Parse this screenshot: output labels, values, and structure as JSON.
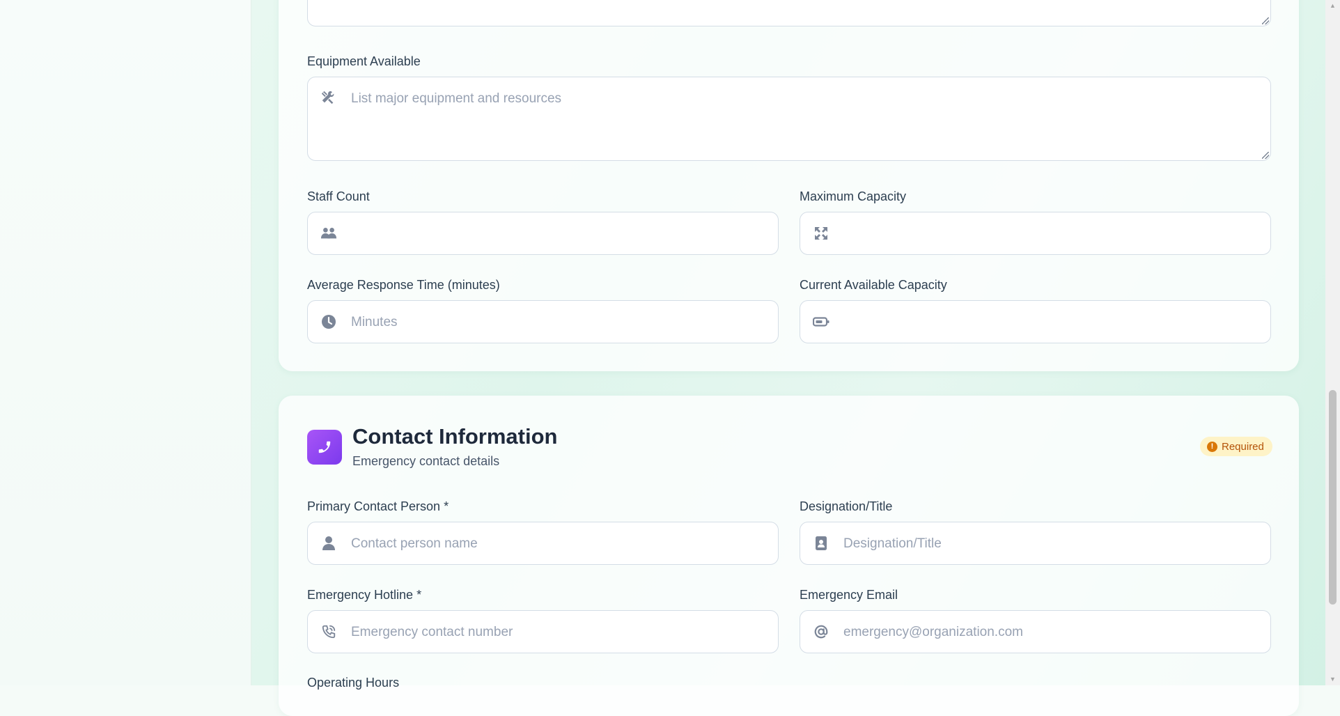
{
  "form": {
    "equipment": {
      "label": "Equipment Available",
      "placeholder": "List major equipment and resources",
      "icon": "tools-icon"
    },
    "staff_count": {
      "label": "Staff Count",
      "placeholder": "",
      "icon": "users-icon"
    },
    "max_capacity": {
      "label": "Maximum Capacity",
      "placeholder": "",
      "icon": "expand-arrows-icon"
    },
    "avg_response": {
      "label": "Average Response Time (minutes)",
      "placeholder": "Minutes",
      "icon": "clock-icon"
    },
    "current_capacity": {
      "label": "Current Available Capacity",
      "placeholder": "",
      "icon": "battery-icon"
    }
  },
  "contact": {
    "title": "Contact Information",
    "subtitle": "Emergency contact details",
    "icon": "phone-icon",
    "badge": "Required",
    "badge_icon": "!",
    "primary_contact": {
      "label": "Primary Contact Person *",
      "placeholder": "Contact person name",
      "icon": "user-icon"
    },
    "designation": {
      "label": "Designation/Title",
      "placeholder": "Designation/Title",
      "icon": "id-badge-icon"
    },
    "hotline": {
      "label": "Emergency Hotline *",
      "placeholder": "Emergency contact number",
      "icon": "phone-volume-icon"
    },
    "email": {
      "label": "Emergency Email",
      "placeholder": "emergency@organization.com",
      "icon": "at-icon"
    },
    "operating_hours": {
      "label": "Operating Hours"
    }
  },
  "colors": {
    "accent_purple": "#8b5cf6",
    "badge_bg": "#fef3c7",
    "badge_text": "#b45309",
    "icon_gray": "#7b8597"
  }
}
